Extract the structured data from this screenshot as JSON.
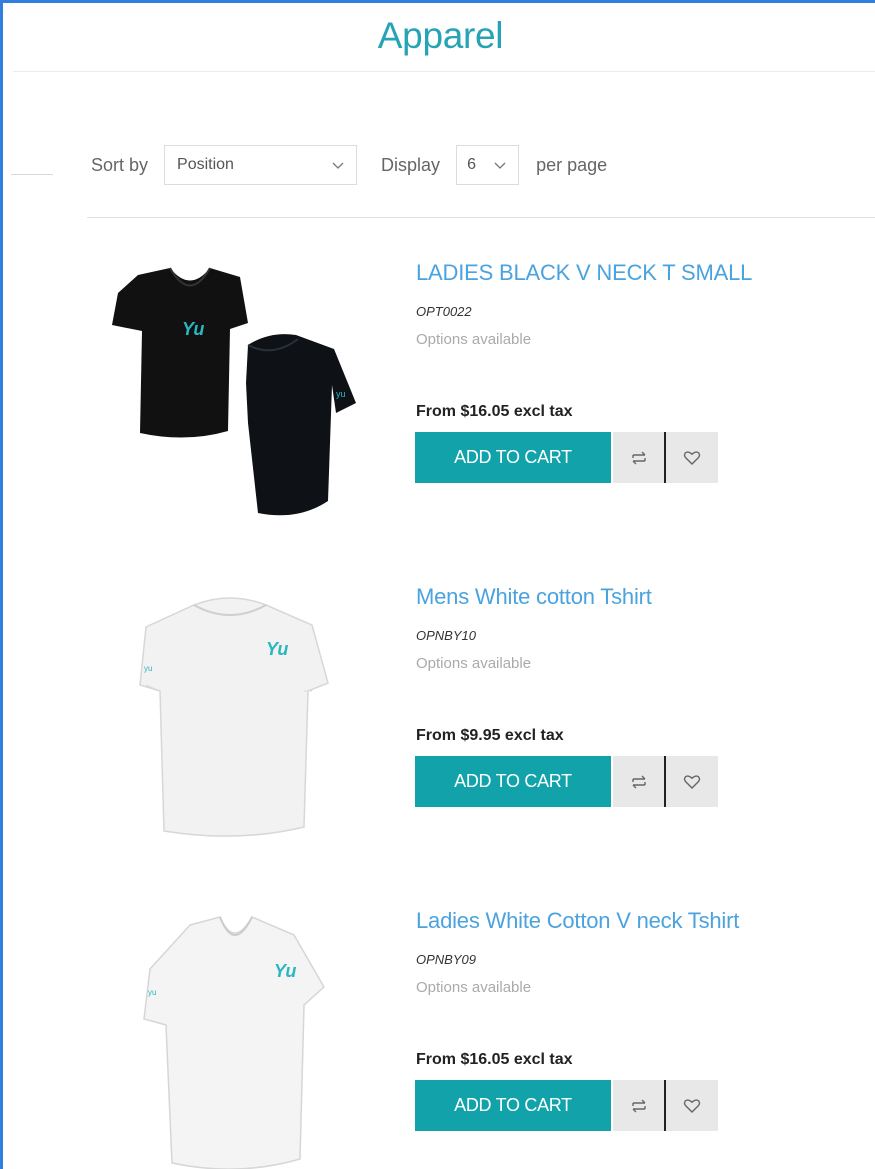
{
  "page": {
    "title": "Apparel"
  },
  "toolbar": {
    "sort_label": "Sort by",
    "sort_value": "Position",
    "display_label": "Display",
    "display_value": "6",
    "per_page_label": "per page"
  },
  "products": [
    {
      "name": "LADIES BLACK V NECK T SMALL",
      "sku": "OPT0022",
      "options": "Options available",
      "price": "From $16.05 excl tax",
      "add_to_cart": "ADD TO CART",
      "image": "black-vneck-tshirt"
    },
    {
      "name": "Mens White cotton Tshirt",
      "sku": "OPNBY10",
      "options": "Options available",
      "price": "From $9.95 excl tax",
      "add_to_cart": "ADD TO CART",
      "image": "white-crew-tshirt"
    },
    {
      "name": "Ladies White Cotton V neck Tshirt",
      "sku": "OPNBY09",
      "options": "Options available",
      "price": "From $16.05 excl tax",
      "add_to_cart": "ADD TO CART",
      "image": "white-vneck-tshirt"
    }
  ],
  "colors": {
    "accent": "#11a3a9",
    "title": "#26a3b5",
    "link": "#4aa3df",
    "logo": "#2ab8c0"
  },
  "icons": {
    "compare": "compare-icon",
    "wishlist": "heart-icon",
    "dropdown": "chevron-down-icon"
  }
}
